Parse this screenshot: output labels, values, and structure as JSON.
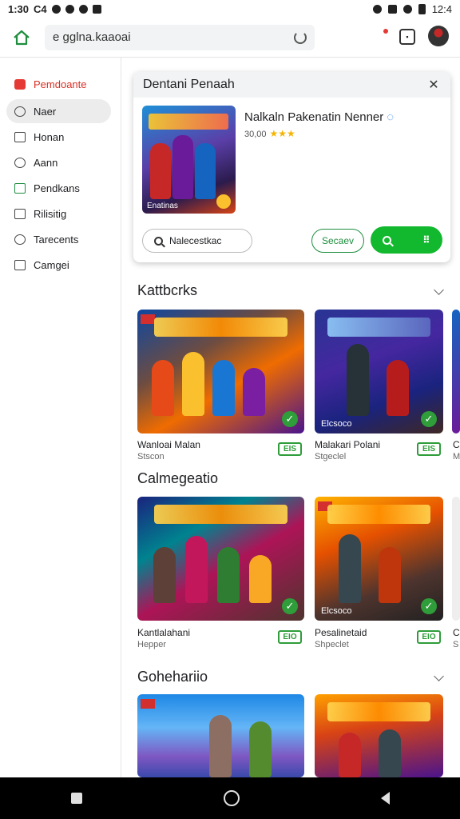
{
  "status": {
    "time": "1:30",
    "carrier": "C4",
    "right_time": "12:4"
  },
  "browser": {
    "url": "e gglna.kaaoai"
  },
  "sidebar": {
    "items": [
      {
        "label": "Pemdoante",
        "icon": "brand-icon"
      },
      {
        "label": "Naer",
        "icon": "compass-icon"
      },
      {
        "label": "Honan",
        "icon": "bookmark-icon"
      },
      {
        "label": "Aann",
        "icon": "people-icon"
      },
      {
        "label": "Pendkans",
        "icon": "edit-icon"
      },
      {
        "label": "Rilisitig",
        "icon": "list-icon"
      },
      {
        "label": "Tarecents",
        "icon": "shield-icon"
      },
      {
        "label": "Camgei",
        "icon": "download-icon"
      }
    ]
  },
  "popup": {
    "title": "Dentani Penaah",
    "app_name": "Nalkaln Pakenatin Nenner",
    "meta": "30,00",
    "stars": "★★★",
    "thumb_caption": "Enatinas",
    "search_label": "Nalecestkac",
    "setup_label": "Secaev",
    "go_label": "⠿"
  },
  "sections": [
    {
      "title": "Kattbcrks",
      "cards": [
        {
          "title": "Wanloai Malan",
          "sub": "Stscon",
          "badge": "EIS",
          "caption": ""
        },
        {
          "title": "Malakari Polani",
          "sub": "Stgeclel",
          "badge": "EIS",
          "caption": "Elcsoco"
        },
        {
          "title": "C",
          "sub": "M",
          "badge": "",
          "caption": ""
        }
      ]
    },
    {
      "title": "Calmegeatio",
      "cards": [
        {
          "title": "Kantlalahani",
          "sub": "Hepper",
          "badge": "EIO",
          "caption": ""
        },
        {
          "title": "Pesalinetaid",
          "sub": "Shpeclet",
          "badge": "EIO",
          "caption": "Elcsoco"
        },
        {
          "title": "C",
          "sub": "S",
          "badge": "",
          "caption": ""
        }
      ]
    },
    {
      "title": "Gohehariio",
      "cards": []
    }
  ]
}
